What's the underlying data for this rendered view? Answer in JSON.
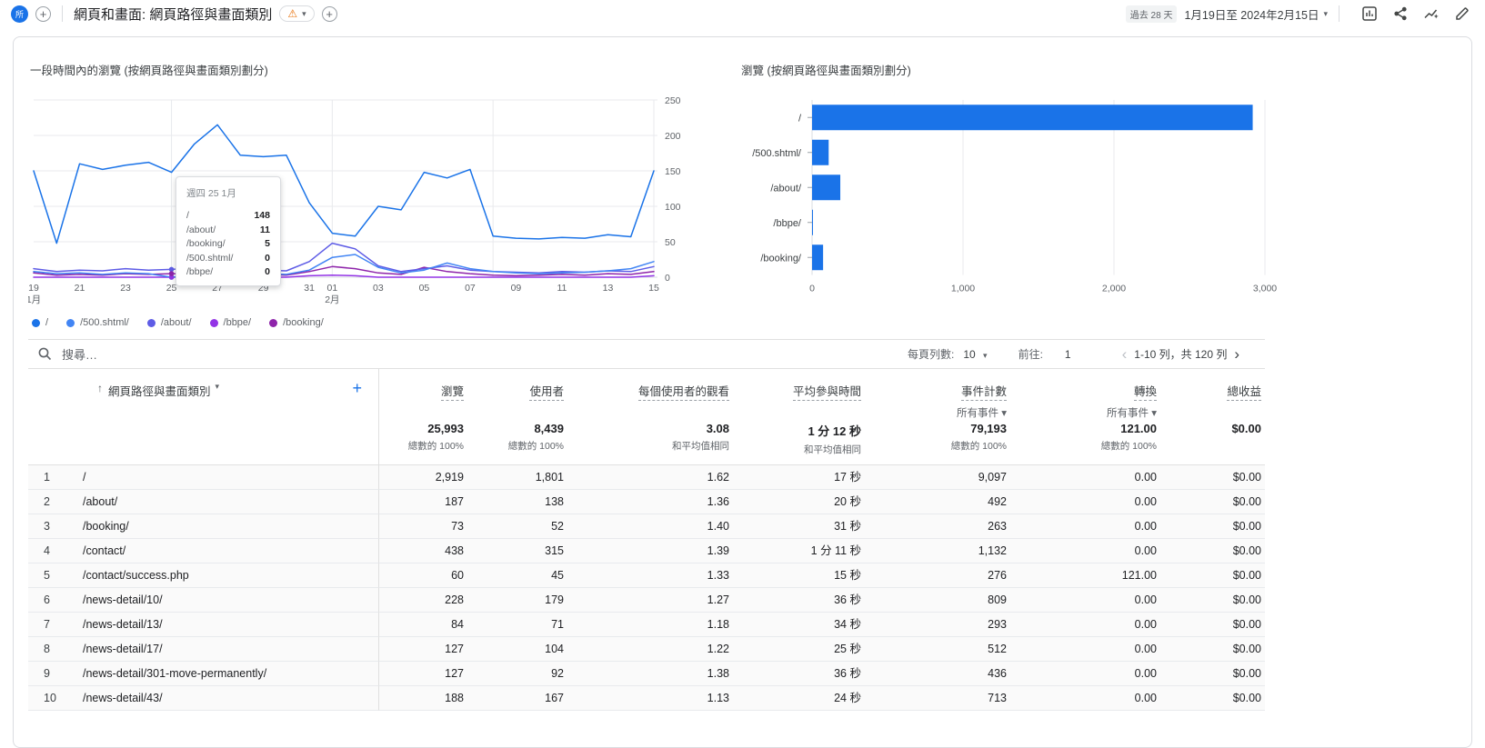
{
  "header": {
    "property_badge": "所",
    "title": "網頁和畫面: 網頁路徑與畫面類別",
    "warning_icon": "⚠",
    "date_chip": "過去 28 天",
    "date_range": "1月19日至 2024年2月15日"
  },
  "chart_data": [
    {
      "type": "line",
      "title": "一段時間內的瀏覽 (按網頁路徑與畫面類別劃分)",
      "ylim": [
        0,
        250
      ],
      "y_ticks": [
        0,
        50,
        100,
        150,
        200,
        250
      ],
      "vertical_grid_indices": [
        6,
        13,
        20,
        27
      ],
      "x_tick_labels": [
        {
          "i": 0,
          "d": "19",
          "m": "1月"
        },
        {
          "i": 2,
          "d": "21"
        },
        {
          "i": 4,
          "d": "23"
        },
        {
          "i": 6,
          "d": "25"
        },
        {
          "i": 8,
          "d": "27"
        },
        {
          "i": 10,
          "d": "29"
        },
        {
          "i": 12,
          "d": "31"
        },
        {
          "i": 13,
          "d": "01",
          "m": "2月"
        },
        {
          "i": 15,
          "d": "03"
        },
        {
          "i": 17,
          "d": "05"
        },
        {
          "i": 19,
          "d": "07"
        },
        {
          "i": 21,
          "d": "09"
        },
        {
          "i": 23,
          "d": "11"
        },
        {
          "i": 25,
          "d": "13"
        },
        {
          "i": 27,
          "d": "15"
        }
      ],
      "series": [
        {
          "name": "/",
          "color": "#1a73e8",
          "values": [
            150,
            48,
            160,
            152,
            158,
            162,
            148,
            188,
            215,
            172,
            170,
            172,
            105,
            62,
            58,
            100,
            95,
            148,
            140,
            152,
            58,
            55,
            54,
            56,
            55,
            60,
            57,
            150
          ]
        },
        {
          "name": "/500.shtml/",
          "color": "#4285f4",
          "values": [
            8,
            5,
            6,
            4,
            6,
            5,
            0,
            4,
            6,
            8,
            5,
            4,
            10,
            28,
            32,
            14,
            6,
            10,
            20,
            12,
            8,
            6,
            5,
            6,
            7,
            9,
            12,
            22
          ]
        },
        {
          "name": "/about/",
          "color": "#5e5ce6",
          "values": [
            12,
            8,
            10,
            9,
            12,
            10,
            11,
            13,
            15,
            12,
            10,
            9,
            22,
            48,
            40,
            16,
            8,
            12,
            16,
            10,
            8,
            7,
            6,
            8,
            7,
            9,
            8,
            15
          ]
        },
        {
          "name": "/bbpe/",
          "color": "#9334e6",
          "values": [
            0,
            0,
            0,
            0,
            0,
            0,
            0,
            0,
            0,
            0,
            0,
            0,
            2,
            3,
            2,
            0,
            0,
            0,
            0,
            0,
            0,
            0,
            0,
            0,
            0,
            0,
            0,
            2
          ]
        },
        {
          "name": "/booking/",
          "color": "#8e24aa",
          "values": [
            6,
            3,
            4,
            3,
            5,
            4,
            5,
            4,
            6,
            5,
            4,
            3,
            8,
            15,
            12,
            6,
            4,
            14,
            8,
            5,
            3,
            2,
            3,
            4,
            3,
            5,
            4,
            8
          ]
        }
      ],
      "legend_position": "bottom",
      "tooltip": {
        "title": "週四 25 1月",
        "point_index": 6,
        "rows": [
          {
            "name": "/",
            "value": "148"
          },
          {
            "name": "/about/",
            "value": "11"
          },
          {
            "name": "/booking/",
            "value": "5"
          },
          {
            "name": "/500.shtml/",
            "value": "0"
          },
          {
            "name": "/bbpe/",
            "value": "0"
          }
        ]
      }
    },
    {
      "type": "bar",
      "orientation": "horizontal",
      "title": "瀏覽 (按網頁路徑與畫面類別劃分)",
      "categories": [
        "/",
        "/500.shtml/",
        "/about/",
        "/bbpe/",
        "/booking/"
      ],
      "values": [
        2919,
        110,
        187,
        2,
        73
      ],
      "bar_color": "#1a73e8",
      "xlim": [
        0,
        3000
      ],
      "x_tick_values": [
        0,
        1000,
        2000,
        3000
      ],
      "x_ticks": [
        "0",
        "1,000",
        "2,000",
        "3,000"
      ]
    }
  ],
  "table": {
    "search_placeholder": "搜尋…",
    "rows_per_page_label": "每頁列數:",
    "rows_per_page_value": "10",
    "goto_label": "前往:",
    "goto_value": "1",
    "range_text": "1-10 列，共 120 列",
    "prev_icon": "‹",
    "next_icon": "›",
    "sort_icon": "↑",
    "dimension_header": "網頁路徑與畫面類別",
    "add_column_label": "+",
    "columns": [
      {
        "label": "瀏覽",
        "sub": ""
      },
      {
        "label": "使用者",
        "sub": ""
      },
      {
        "label": "每個使用者的觀看",
        "sub": ""
      },
      {
        "label": "平均參與時間",
        "sub": ""
      },
      {
        "label": "事件計數",
        "sub": "所有事件"
      },
      {
        "label": "轉換",
        "sub": "所有事件"
      },
      {
        "label": "總收益",
        "sub": ""
      }
    ],
    "totals": {
      "values": [
        "25,993",
        "8,439",
        "3.08",
        "1 分 12 秒",
        "79,193",
        "121.00",
        "$0.00"
      ],
      "subs": [
        "總數的 100%",
        "總數的 100%",
        "和平均值相同",
        "和平均值相同",
        "總數的 100%",
        "總數的 100%",
        ""
      ]
    },
    "rows": [
      {
        "num": "1",
        "path": "/",
        "cells": [
          "2,919",
          "1,801",
          "1.62",
          "17 秒",
          "9,097",
          "0.00",
          "$0.00"
        ]
      },
      {
        "num": "2",
        "path": "/about/",
        "cells": [
          "187",
          "138",
          "1.36",
          "20 秒",
          "492",
          "0.00",
          "$0.00"
        ]
      },
      {
        "num": "3",
        "path": "/booking/",
        "cells": [
          "73",
          "52",
          "1.40",
          "31 秒",
          "263",
          "0.00",
          "$0.00"
        ]
      },
      {
        "num": "4",
        "path": "/contact/",
        "cells": [
          "438",
          "315",
          "1.39",
          "1 分 11 秒",
          "1,132",
          "0.00",
          "$0.00"
        ]
      },
      {
        "num": "5",
        "path": "/contact/success.php",
        "cells": [
          "60",
          "45",
          "1.33",
          "15 秒",
          "276",
          "121.00",
          "$0.00"
        ]
      },
      {
        "num": "6",
        "path": "/news-detail/10/",
        "cells": [
          "228",
          "179",
          "1.27",
          "36 秒",
          "809",
          "0.00",
          "$0.00"
        ]
      },
      {
        "num": "7",
        "path": "/news-detail/13/",
        "cells": [
          "84",
          "71",
          "1.18",
          "34 秒",
          "293",
          "0.00",
          "$0.00"
        ]
      },
      {
        "num": "8",
        "path": "/news-detail/17/",
        "cells": [
          "127",
          "104",
          "1.22",
          "25 秒",
          "512",
          "0.00",
          "$0.00"
        ]
      },
      {
        "num": "9",
        "path": "/news-detail/301-move-permanently/",
        "cells": [
          "127",
          "92",
          "1.38",
          "36 秒",
          "436",
          "0.00",
          "$0.00"
        ]
      },
      {
        "num": "10",
        "path": "/news-detail/43/",
        "cells": [
          "188",
          "167",
          "1.13",
          "24 秒",
          "713",
          "0.00",
          "$0.00"
        ]
      }
    ]
  }
}
